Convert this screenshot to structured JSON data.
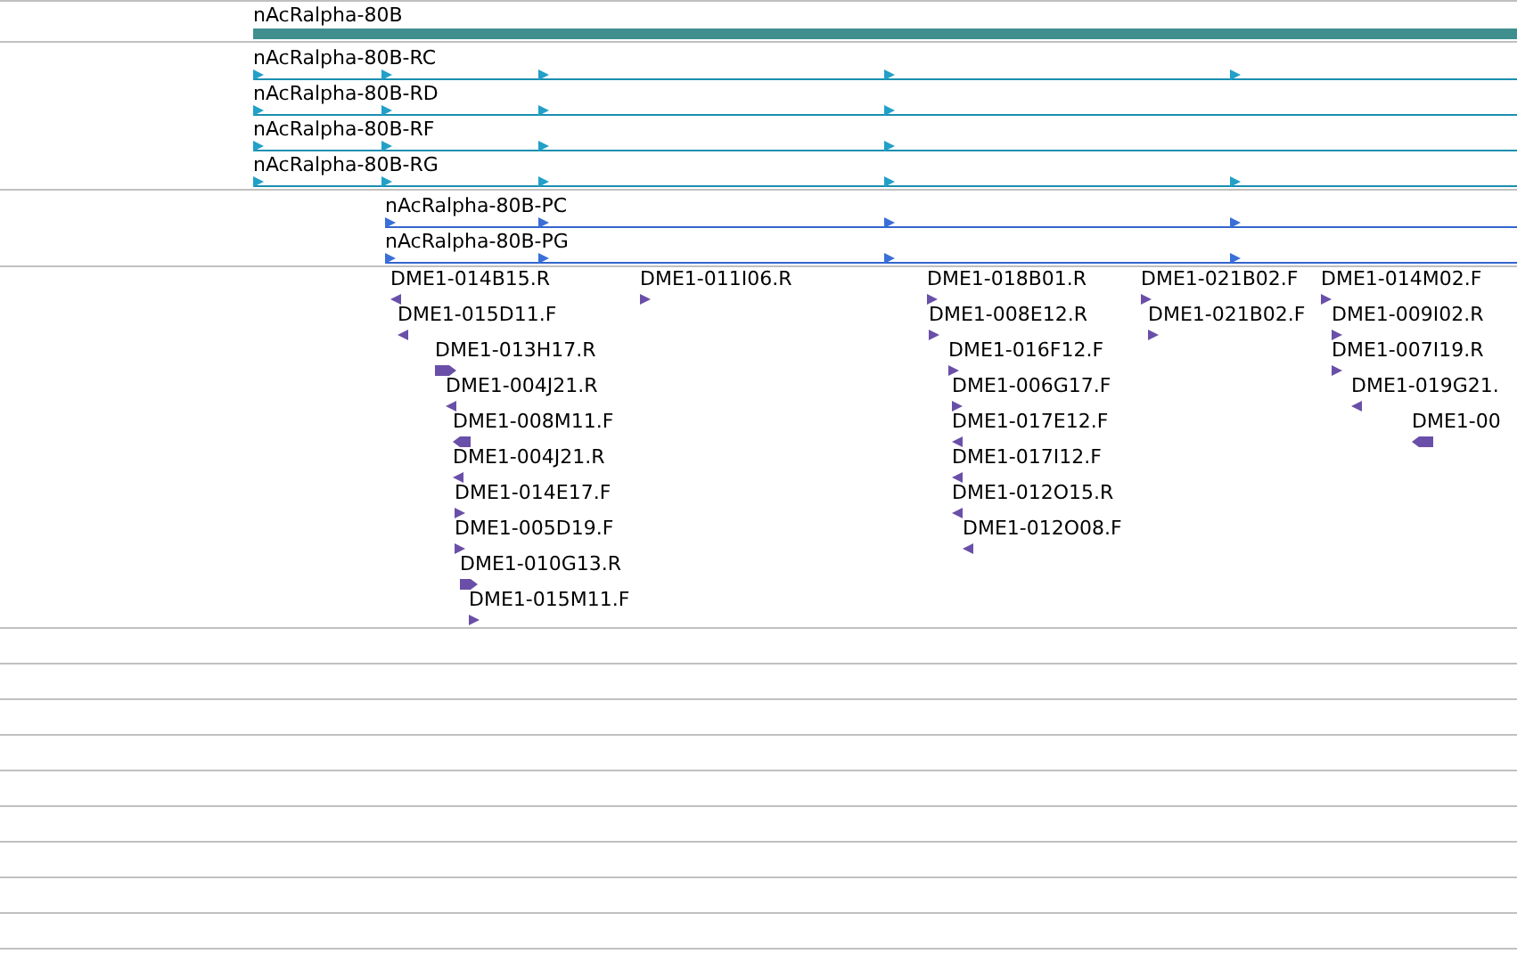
{
  "gene": {
    "label": "nAcRalpha-80B"
  },
  "transcripts": [
    {
      "label": "nAcRalpha-80B-RC"
    },
    {
      "label": "nAcRalpha-80B-RD"
    },
    {
      "label": "nAcRalpha-80B-RF"
    },
    {
      "label": "nAcRalpha-80B-RG"
    }
  ],
  "proteins": [
    {
      "label": "nAcRalpha-80B-PC"
    },
    {
      "label": "nAcRalpha-80B-PG"
    }
  ],
  "clones": [
    {
      "label": "DME1-014B15.R",
      "kind": "reverse"
    },
    {
      "label": "DME1-011I06.R",
      "kind": "forward"
    },
    {
      "label": "DME1-018B01.R",
      "kind": "forward"
    },
    {
      "label": "DME1-021B02.F",
      "kind": "forward"
    },
    {
      "label": "DME1-014M02.F",
      "kind": "forward"
    },
    {
      "label": "DME1-015D11.F",
      "kind": "reverse"
    },
    {
      "label": "DME1-008E12.R",
      "kind": "forward"
    },
    {
      "label": "DME1-021B02.F",
      "kind": "forward"
    },
    {
      "label": "DME1-009I02.R",
      "kind": "forward"
    },
    {
      "label": "DME1-013H17.R",
      "kind": "forward"
    },
    {
      "label": "DME1-016F12.F",
      "kind": "forward"
    },
    {
      "label": "DME1-007I19.R",
      "kind": "forward"
    },
    {
      "label": "DME1-004J21.R",
      "kind": "reverse"
    },
    {
      "label": "DME1-006G17.F",
      "kind": "forward"
    },
    {
      "label": "DME1-019G21.",
      "kind": "reverse"
    },
    {
      "label": "DME1-008M11.F",
      "kind": "reverse"
    },
    {
      "label": "DME1-017E12.F",
      "kind": "reverse"
    },
    {
      "label": "DME1-00",
      "kind": "reverse"
    },
    {
      "label": "DME1-004J21.R",
      "kind": "reverse"
    },
    {
      "label": "DME1-017I12.F",
      "kind": "reverse"
    },
    {
      "label": "DME1-014E17.F",
      "kind": "forward"
    },
    {
      "label": "DME1-012O15.R",
      "kind": "reverse"
    },
    {
      "label": "DME1-005D19.F",
      "kind": "forward"
    },
    {
      "label": "DME1-012O08.F",
      "kind": "reverse"
    },
    {
      "label": "DME1-010G13.R",
      "kind": "forward"
    },
    {
      "label": "DME1-015M11.F",
      "kind": "forward"
    }
  ]
}
